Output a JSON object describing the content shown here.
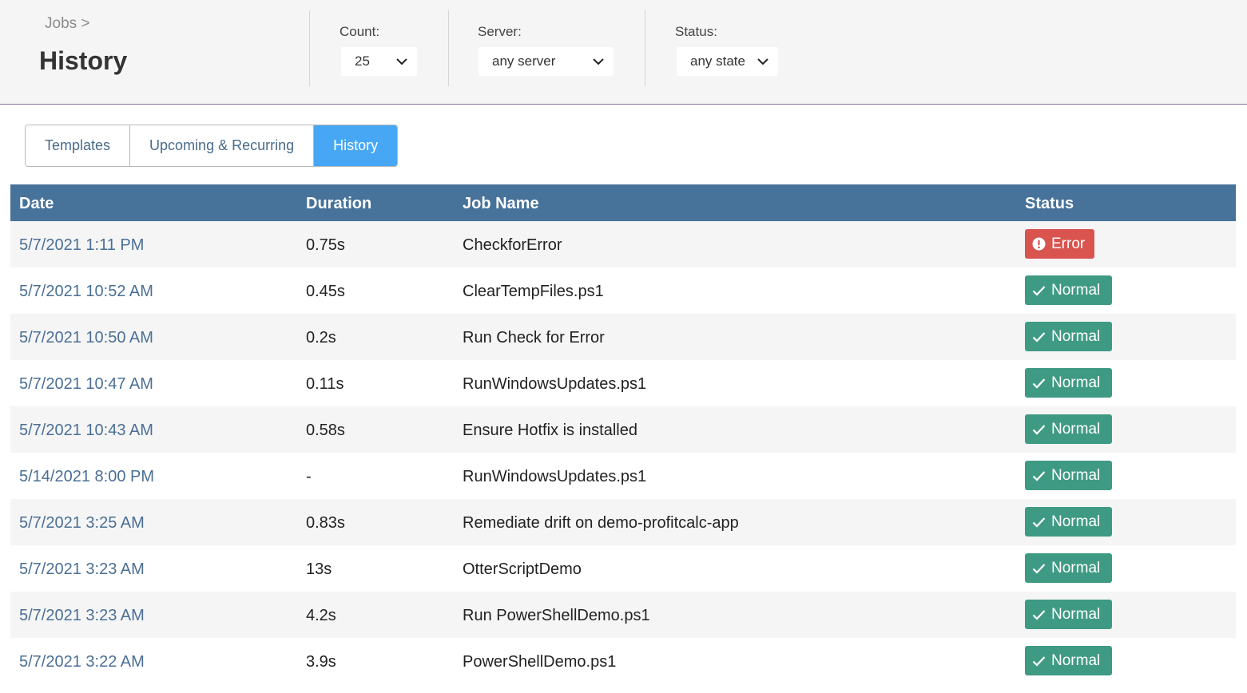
{
  "breadcrumb": "Jobs >",
  "page_title": "History",
  "filters": {
    "count": {
      "label": "Count:",
      "value": "25"
    },
    "server": {
      "label": "Server:",
      "value": "any server"
    },
    "status": {
      "label": "Status:",
      "value": "any state"
    }
  },
  "tabs": [
    {
      "label": "Templates",
      "active": false
    },
    {
      "label": "Upcoming & Recurring",
      "active": false
    },
    {
      "label": "History",
      "active": true
    }
  ],
  "table": {
    "columns": [
      "Date",
      "Duration",
      "Job Name",
      "Status"
    ],
    "rows": [
      {
        "date": "5/7/2021 1:11 PM",
        "duration": "0.75s",
        "job": "CheckforError",
        "status": "Error"
      },
      {
        "date": "5/7/2021 10:52 AM",
        "duration": "0.45s",
        "job": "ClearTempFiles.ps1",
        "status": "Normal"
      },
      {
        "date": "5/7/2021 10:50 AM",
        "duration": "0.2s",
        "job": "Run Check for Error",
        "status": "Normal"
      },
      {
        "date": "5/7/2021 10:47 AM",
        "duration": "0.11s",
        "job": "RunWindowsUpdates.ps1",
        "status": "Normal"
      },
      {
        "date": "5/7/2021 10:43 AM",
        "duration": "0.58s",
        "job": "Ensure Hotfix is installed",
        "status": "Normal"
      },
      {
        "date": "5/14/2021 8:00 PM",
        "duration": "-",
        "job": "RunWindowsUpdates.ps1",
        "status": "Normal"
      },
      {
        "date": "5/7/2021 3:25 AM",
        "duration": "0.83s",
        "job": "Remediate drift on demo-profitcalc-app",
        "status": "Normal"
      },
      {
        "date": "5/7/2021 3:23 AM",
        "duration": "13s",
        "job": "OtterScriptDemo",
        "status": "Normal"
      },
      {
        "date": "5/7/2021 3:23 AM",
        "duration": "4.2s",
        "job": "Run PowerShellDemo.ps1",
        "status": "Normal"
      },
      {
        "date": "5/7/2021 3:22 AM",
        "duration": "3.9s",
        "job": "PowerShellDemo.ps1",
        "status": "Normal"
      }
    ]
  },
  "colors": {
    "header": "#47729a",
    "active_tab": "#47a7f5",
    "normal_badge": "#3f9a84",
    "error_badge": "#d9534f",
    "link": "#4a6f96"
  },
  "icons": {
    "select": "chevron-down-icon",
    "normal": "check-icon",
    "error": "alert-circle-icon"
  }
}
